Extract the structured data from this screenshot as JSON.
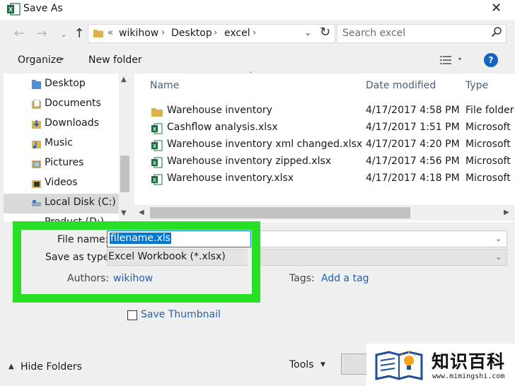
{
  "window": {
    "title": "Save As",
    "close_glyph": "✕"
  },
  "address": {
    "crumbs": [
      "wikihow",
      "Desktop",
      "excel"
    ],
    "search_placeholder": "Search excel"
  },
  "toolbar": {
    "organize": "Organize",
    "new_folder": "New folder",
    "help": "?"
  },
  "nav": {
    "items": [
      {
        "label": "Desktop",
        "icon": "folder-icon"
      },
      {
        "label": "Documents",
        "icon": "documents-icon"
      },
      {
        "label": "Downloads",
        "icon": "downloads-icon"
      },
      {
        "label": "Music",
        "icon": "music-icon"
      },
      {
        "label": "Pictures",
        "icon": "pictures-icon"
      },
      {
        "label": "Videos",
        "icon": "videos-icon"
      },
      {
        "label": "Local Disk (C:)",
        "icon": "drive-icon"
      },
      {
        "label": "Product (D:)",
        "icon": "drive-icon"
      }
    ]
  },
  "files": {
    "columns": [
      "Name",
      "Date modified",
      "Type"
    ],
    "rows": [
      {
        "name": "Warehouse inventory",
        "date": "4/17/2017 4:58 PM",
        "type": "File folder",
        "icon": "folder-icon"
      },
      {
        "name": "Cashflow analysis.xlsx",
        "date": "4/17/2017 1:51 PM",
        "type": "Microsoft",
        "icon": "excel-file-icon"
      },
      {
        "name": "Warehouse inventory xml changed.xlsx",
        "date": "4/17/2017 4:20 PM",
        "type": "Microsoft",
        "icon": "excel-file-icon"
      },
      {
        "name": "Warehouse inventory zipped.xlsx",
        "date": "4/17/2017 4:56 PM",
        "type": "Microsoft",
        "icon": "excel-file-icon"
      },
      {
        "name": "Warehouse inventory.xlsx",
        "date": "4/17/2017 4:18 PM",
        "type": "Microsoft",
        "icon": "excel-file-icon"
      }
    ]
  },
  "form": {
    "file_name_label": "File name:",
    "file_name_value": "filename.xls",
    "save_type_label": "Save as type:",
    "save_type_value": "Excel Workbook (*.xlsx)",
    "authors_label": "Authors:",
    "authors_value": "wikihow",
    "tags_label": "Tags:",
    "tags_value": "Add a tag",
    "thumbnail_label": "Save Thumbnail",
    "thumbnail_checked": false,
    "hide_folders": "Hide Folders",
    "tools": "Tools"
  },
  "colors": {
    "highlight": "#27e026",
    "accent": "#0078d7",
    "link": "#1f5fb5"
  },
  "watermark": {
    "text": "知识百科",
    "url": "www.mimingshi.com"
  }
}
